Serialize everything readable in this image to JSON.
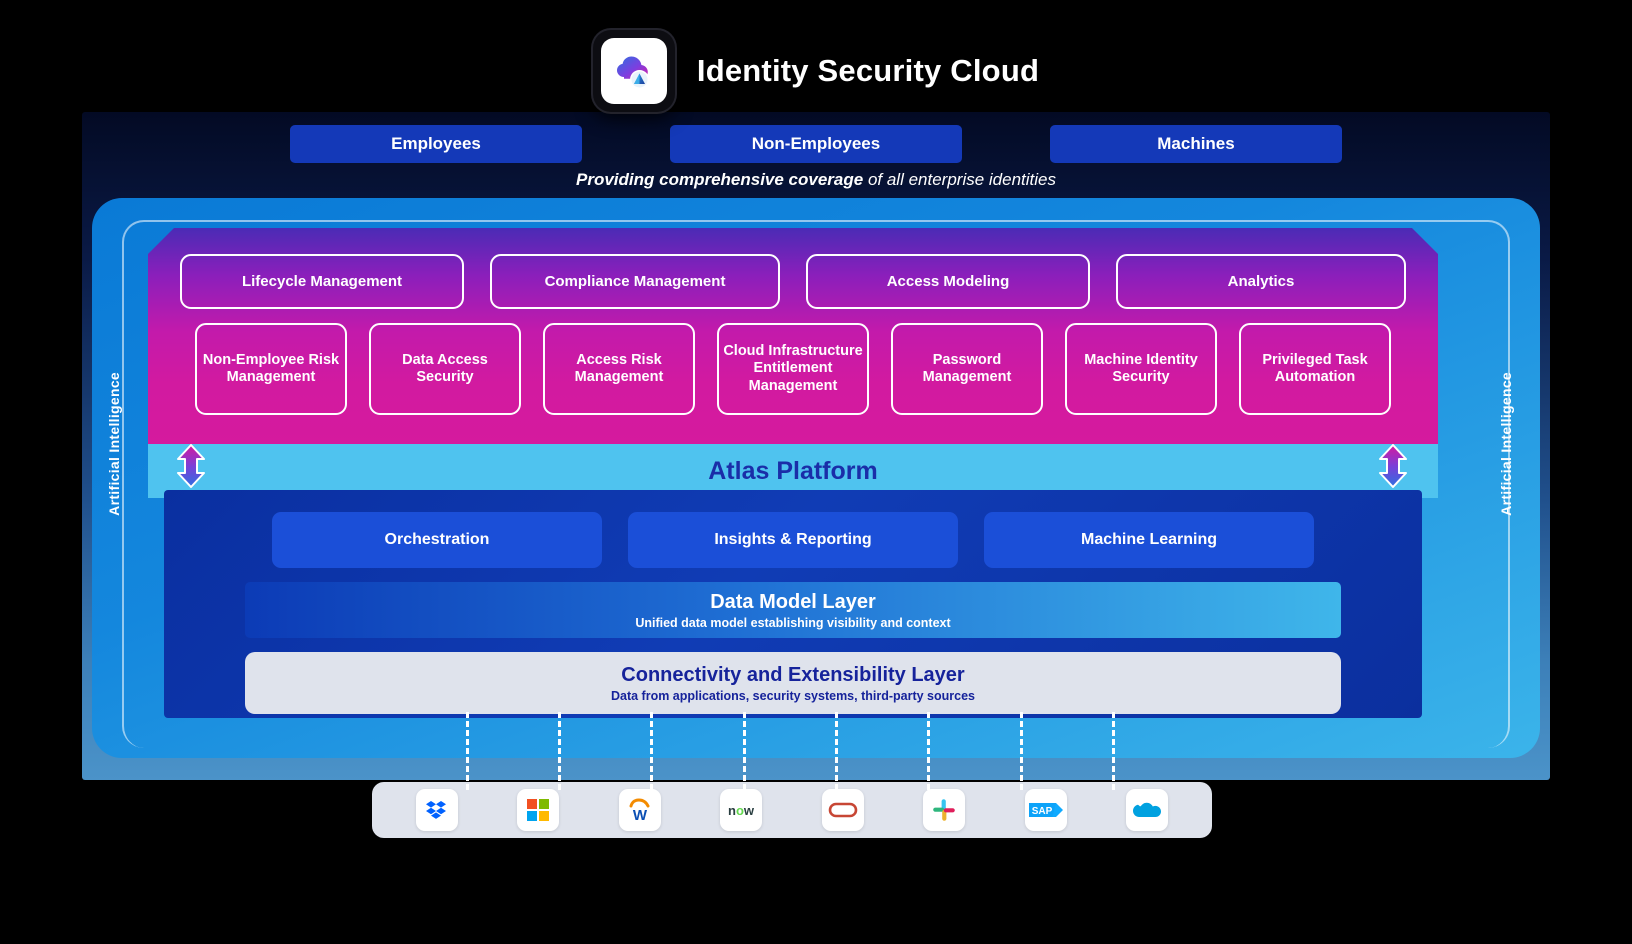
{
  "header": {
    "title": "Identity Security Cloud",
    "icon": "cloud-identity-icon"
  },
  "identity_tiers": [
    {
      "label": "Employees"
    },
    {
      "label": "Non-Employees"
    },
    {
      "label": "Machines"
    }
  ],
  "tagline": {
    "bold": "Providing comprehensive coverage",
    "rest": " of all enterprise identities"
  },
  "ai_label": "Artificial Intelligence",
  "capabilities": {
    "row1": [
      {
        "label": "Lifecycle Management"
      },
      {
        "label": "Compliance Management"
      },
      {
        "label": "Access Modeling"
      },
      {
        "label": "Analytics"
      }
    ],
    "row2": [
      {
        "label": "Non-Employee Risk Management"
      },
      {
        "label": "Data Access Security"
      },
      {
        "label": "Access Risk Management"
      },
      {
        "label": "Cloud Infrastructure Entitlement Management"
      },
      {
        "label": "Password Management"
      },
      {
        "label": "Machine Identity Security"
      },
      {
        "label": "Privileged Task Automation"
      }
    ]
  },
  "atlas": {
    "title": "Atlas Platform"
  },
  "platform_services": [
    {
      "label": "Orchestration"
    },
    {
      "label": "Insights & Reporting"
    },
    {
      "label": "Machine Learning"
    }
  ],
  "data_model_layer": {
    "title": "Data Model Layer",
    "subtitle": "Unified data model establishing visibility and context"
  },
  "connectivity_layer": {
    "title": "Connectivity and Extensibility Layer",
    "subtitle": "Data from applications, security systems, third-party sources"
  },
  "integrations": [
    {
      "name": "dropbox-icon"
    },
    {
      "name": "microsoft-icon"
    },
    {
      "name": "workday-icon"
    },
    {
      "name": "servicenow-icon"
    },
    {
      "name": "oracle-icon"
    },
    {
      "name": "slack-icon"
    },
    {
      "name": "sap-icon"
    },
    {
      "name": "salesforce-icon"
    }
  ],
  "colors": {
    "tier_blue": "#1439b8",
    "pink": "#d21aa0",
    "purple": "#4b2bb5",
    "atlas_cyan": "#4fc3ef",
    "atlas_text": "#1a2ea8",
    "platform_blue": "#103cb5",
    "service_blue": "#1b4fd8",
    "panel_gray": "#dfe3ec",
    "deep_navy": "#030a24"
  }
}
